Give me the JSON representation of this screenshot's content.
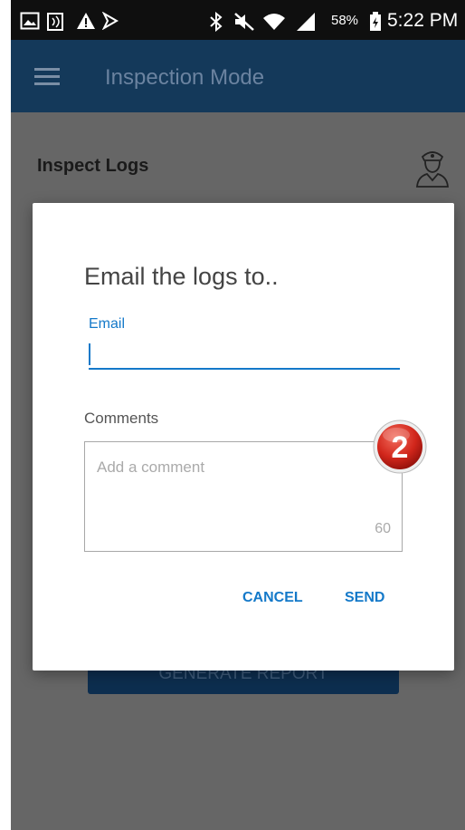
{
  "status_bar": {
    "icons": [
      "gallery-icon",
      "nfc-icon",
      "warning-icon",
      "direction-icon",
      "bluetooth-icon",
      "mute-icon",
      "wifi-icon",
      "signal-icon",
      "battery-icon"
    ],
    "battery_percent": "58%",
    "time": "5:22 PM"
  },
  "app_bar": {
    "title": "Inspection Mode",
    "color": "#14395a"
  },
  "page": {
    "title": "Inspect Logs",
    "generate_button_label": "GENERATE REPORT"
  },
  "dialog": {
    "title": "Email the logs to..",
    "email_label": "Email",
    "email_value": "",
    "comments_label": "Comments",
    "comment_placeholder": "Add a comment",
    "comment_counter": "60",
    "badge_number": "2",
    "cancel_label": "CANCEL",
    "send_label": "SEND",
    "accent_color": "#1479c9"
  }
}
